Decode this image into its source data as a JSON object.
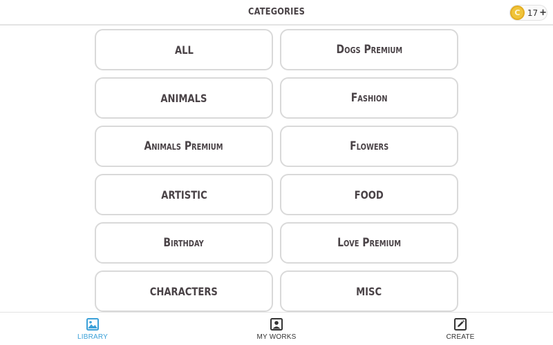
{
  "header": {
    "title": "CATEGORIES",
    "coins": {
      "icon": "coin-icon",
      "symbol": "C",
      "count": "17",
      "plus": "+"
    }
  },
  "categories": [
    {
      "label": "ALL",
      "style": "caps"
    },
    {
      "label": "Dogs Premium",
      "style": "smallcaps"
    },
    {
      "label": "ANIMALS",
      "style": "caps"
    },
    {
      "label": "Fashion",
      "style": "smallcaps"
    },
    {
      "label": "Animals Premium",
      "style": "smallcaps"
    },
    {
      "label": "Flowers",
      "style": "smallcaps"
    },
    {
      "label": "ARTISTIC",
      "style": "caps"
    },
    {
      "label": "FOOD",
      "style": "caps"
    },
    {
      "label": "Birthday",
      "style": "smallcaps"
    },
    {
      "label": "Love Premium",
      "style": "smallcaps"
    },
    {
      "label": "CHARACTERS",
      "style": "caps"
    },
    {
      "label": "MISC",
      "style": "caps"
    }
  ],
  "tabs": [
    {
      "label": "LIBRARY",
      "icon": "image-icon",
      "active": true
    },
    {
      "label": "MY WORKS",
      "icon": "portrait-icon",
      "active": false
    },
    {
      "label": "CREATE",
      "icon": "pencil-icon",
      "active": false
    }
  ],
  "colors": {
    "accent": "#3aa0d8",
    "text": "#4a4347",
    "card_border": "#d9d9d9",
    "coin": "#f0c43a"
  }
}
